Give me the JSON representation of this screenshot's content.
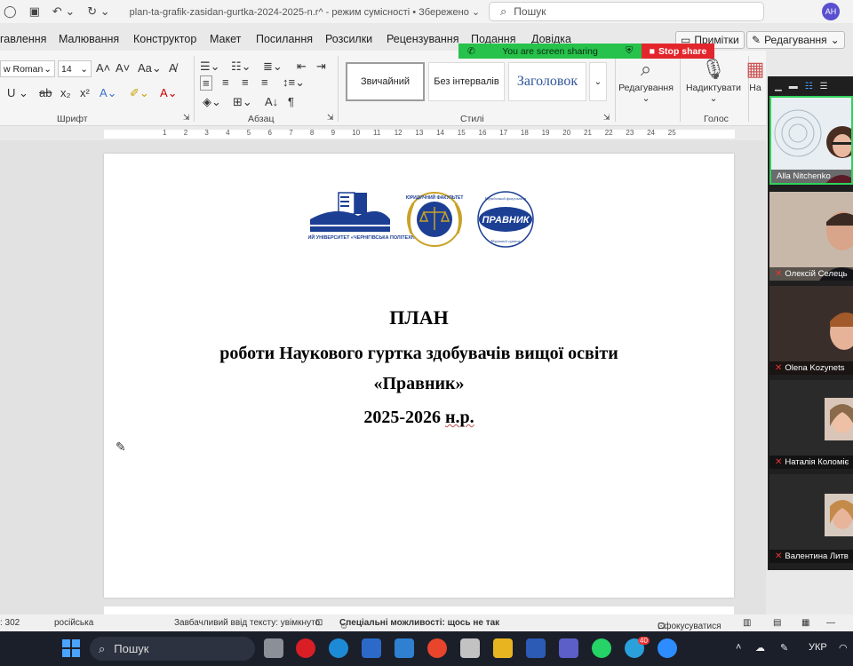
{
  "titlebar": {
    "doc_title": "plan-ta-grafik-zasidan-gurtka-2024-2025-n.r^  -  режим сумісності • Збережено ⌄",
    "search_placeholder": "Пошук",
    "user_initials": "AH"
  },
  "menu": {
    "items": [
      "гавлення",
      "Малювання",
      "Конструктор",
      "Макет",
      "Посилання",
      "Розсилки",
      "Рецензування",
      "Подання",
      "Довідка"
    ],
    "notes_button": "Примітки",
    "editing_button": "Редагування"
  },
  "share_banner": {
    "status": "You are screen sharing",
    "stop": "Stop share"
  },
  "ribbon": {
    "font_name": "w Roman",
    "font_size": "14",
    "groups": {
      "font": "Шрифт",
      "paragraph": "Абзац",
      "styles": "Стилі",
      "voice": "Голос"
    },
    "styles": [
      "Звичайний",
      "Без інтервалів",
      "Заголовок"
    ],
    "editing": "Редагування",
    "dictate": "Надиктувати",
    "clipped": "На"
  },
  "ruler": {
    "marks": [
      "1",
      "2",
      "3",
      "4",
      "5",
      "6",
      "7",
      "8",
      "9",
      "10",
      "11",
      "12",
      "13",
      "14",
      "15",
      "16",
      "17",
      "18",
      "19",
      "20",
      "21",
      "22",
      "23",
      "24",
      "25"
    ]
  },
  "document": {
    "logos": {
      "university": "НАЦІОНАЛЬНИЙ УНІВЕРСИТЕТ «ЧЕРНІГІВСЬКА ПОЛІТЕХНІКА»",
      "faculty": "ЮРИДИЧНИЙ ФАКУЛЬТЕТ",
      "club": "ПРАВНИК",
      "club_top": "Юридичний факультет",
      "club_bottom": "Науковий гурток"
    },
    "line1": "ПЛАН",
    "line2": "роботи Наукового гуртка здобувачів вищої освіти",
    "line3": "«Правник»",
    "line4_year": "2025-2026",
    "line4_suffix": "н.р."
  },
  "zoom": {
    "participants": [
      {
        "name": "Alla Nitchenko",
        "muted": false
      },
      {
        "name": "Олексій Селець",
        "muted": true
      },
      {
        "name": "Olena Kozynets",
        "muted": true
      },
      {
        "name": "Наталія Коломіє",
        "muted": true
      },
      {
        "name": "Валентина Литв",
        "muted": true
      }
    ]
  },
  "statusbar": {
    "words": ": 302",
    "language": "російська",
    "predictive": "Завбачливий ввід тексту: увімкнуто",
    "accessibility": "Спеціальні можливості: щось не так",
    "focus": "Сфокусуватися"
  },
  "taskbar": {
    "search": "Пошук",
    "keyboard_lang": "УКР",
    "telegram_badge": "40"
  },
  "colors": {
    "share_green": "#26c24b",
    "share_red": "#e2262c",
    "logo_blue": "#1c3f94",
    "logo_gold": "#c9a227"
  }
}
